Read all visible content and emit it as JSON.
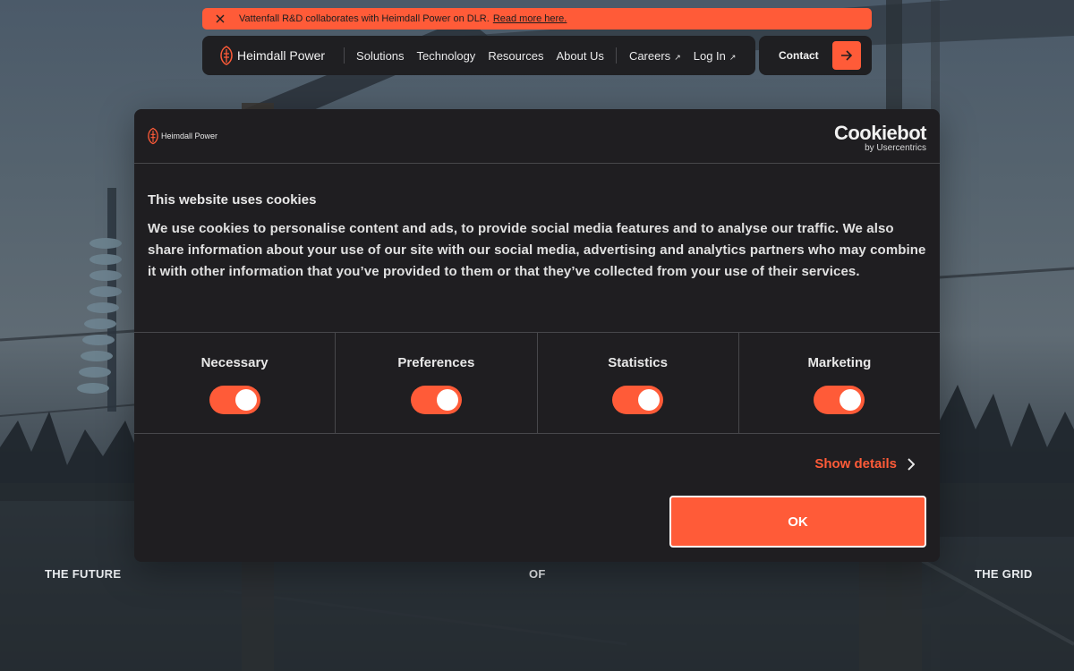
{
  "announcement": {
    "message": "Vattenfall R&D collaborates with Heimdall Power on DLR.",
    "link": "Read more here."
  },
  "nav": {
    "brand": "Heimdall Power",
    "items": [
      "Solutions",
      "Technology",
      "Resources",
      "About Us"
    ],
    "external": [
      "Careers",
      "Log In"
    ],
    "contact": "Contact"
  },
  "hero": {
    "left": "THE FUTURE",
    "middle": "OF",
    "right": "THE GRID"
  },
  "cookie": {
    "brand": "Heimdall Power",
    "provider": "Cookiebot",
    "provider_sub": "by Usercentrics",
    "title": "This website uses cookies",
    "body": "We use cookies to personalise content and ads, to provide social media features and to analyse our traffic. We also share information about your use of our site with our social media, advertising and analytics partners who may combine it with other information that you’ve provided to them or that they’ve collected from your use of their services.",
    "categories": [
      {
        "label": "Necessary",
        "enabled": true
      },
      {
        "label": "Preferences",
        "enabled": true
      },
      {
        "label": "Statistics",
        "enabled": true
      },
      {
        "label": "Marketing",
        "enabled": true
      }
    ],
    "details": "Show details",
    "ok": "OK"
  },
  "colors": {
    "accent": "#ff5b38",
    "panel": "#1f1f22"
  },
  "icons": {
    "close": "close-icon",
    "arrow": "arrow-right-icon",
    "external": "external-arrow-icon",
    "chevron": "chevron-right-icon"
  }
}
